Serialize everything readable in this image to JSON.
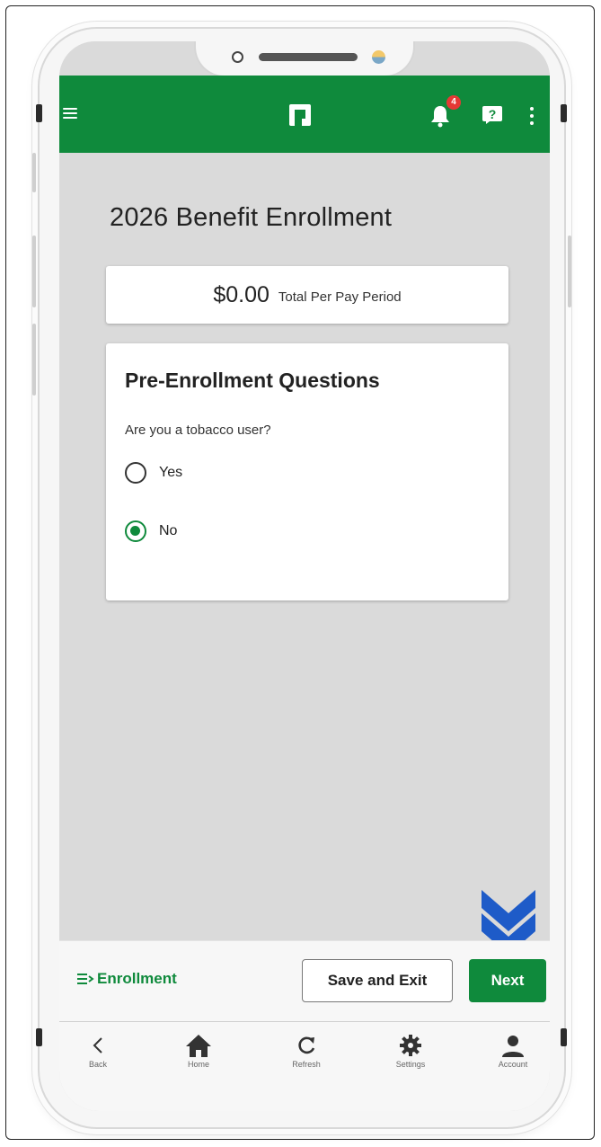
{
  "appbar": {
    "notification_count": "4",
    "brand_color": "#0f8a3c"
  },
  "page": {
    "title": "2026 Benefit Enrollment"
  },
  "total": {
    "amount": "$0.00",
    "label": "Total Per Pay Period"
  },
  "questions": {
    "title": "Pre-Enrollment Questions",
    "question": "Are you a tobacco user?",
    "options": [
      {
        "label": "Yes",
        "selected": false
      },
      {
        "label": "No",
        "selected": true
      }
    ]
  },
  "footer": {
    "enrollment_link": "Enrollment",
    "save_label": "Save and Exit",
    "next_label": "Next"
  },
  "nav": {
    "items": [
      {
        "label": "Back",
        "icon": "back-icon"
      },
      {
        "label": "Home",
        "icon": "home-icon"
      },
      {
        "label": "Refresh",
        "icon": "refresh-icon"
      },
      {
        "label": "Settings",
        "icon": "gear-icon"
      },
      {
        "label": "Account",
        "icon": "account-icon"
      }
    ]
  }
}
